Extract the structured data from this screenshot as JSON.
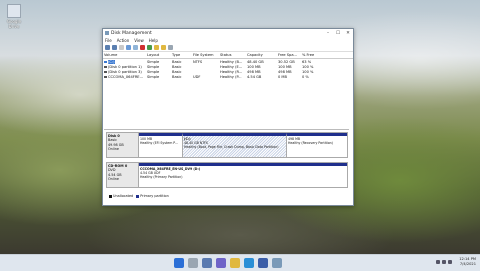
{
  "desktop": {
    "icon_label": "Google Drive"
  },
  "window": {
    "title": "Disk Management",
    "minimize": "–",
    "maximize": "☐",
    "close": "✕"
  },
  "menu": [
    "File",
    "Action",
    "View",
    "Help"
  ],
  "toolbar_icons": [
    "back-icon",
    "forward-icon",
    "properties-icon",
    "help-icon",
    "refresh-icon",
    "delete-icon",
    "checkmark-icon",
    "open-icon",
    "explore-icon",
    "view-icon"
  ],
  "columns": [
    "Volume",
    "Layout",
    "Type",
    "File System",
    "Status",
    "Capacity",
    "Free Spa...",
    "% Free"
  ],
  "volumes": [
    [
      "(C:)",
      "Simple",
      "Basic",
      "NTFS",
      "Healthy (B...",
      "48.40 GB",
      "30.52 GB",
      "63 %"
    ],
    [
      "(Disk 0 partition 1)",
      "Simple",
      "Basic",
      "",
      "Healthy (E...",
      "100 MB",
      "100 MB",
      "100 %"
    ],
    [
      "(Disk 0 partition 3)",
      "Simple",
      "Basic",
      "",
      "Healthy (R...",
      "498 MB",
      "498 MB",
      "100 %"
    ],
    [
      "CCCOMA_X64FRE...",
      "Simple",
      "Basic",
      "UDF",
      "Healthy (P...",
      "4.54 GB",
      "0 MB",
      "0 %"
    ]
  ],
  "disk0": {
    "name": "Disk 0",
    "type": "Basic",
    "size": "49.98 GB",
    "status": "Online",
    "parts": [
      {
        "name": "",
        "size": "100 MB",
        "desc": "Healthy (EFI System P..."
      },
      {
        "name": "(C:)",
        "size": "48.40 GB NTFS",
        "desc": "Healthy (Boot, Page File, Crash Dump, Basic Data Partition)"
      },
      {
        "name": "",
        "size": "498 MB",
        "desc": "Healthy (Recovery Partition)"
      }
    ]
  },
  "cdrom": {
    "name": "CD-ROM 0",
    "type": "DVD",
    "size": "4.54 GB",
    "status": "Online",
    "part": {
      "name": "CCCOMA_X64FRE_EN-US_DV9 (D:)",
      "size": "4.54 GB UDF",
      "desc": "Healthy (Primary Partition)"
    }
  },
  "legend": [
    "Unallocated",
    "Primary partition"
  ],
  "colors": {
    "unallocated": "#111111",
    "primary": "#1f2f8c",
    "selection": "#3a78d0"
  },
  "taskbar": {
    "time": "12:14 PM",
    "date": "7/4/2021"
  }
}
